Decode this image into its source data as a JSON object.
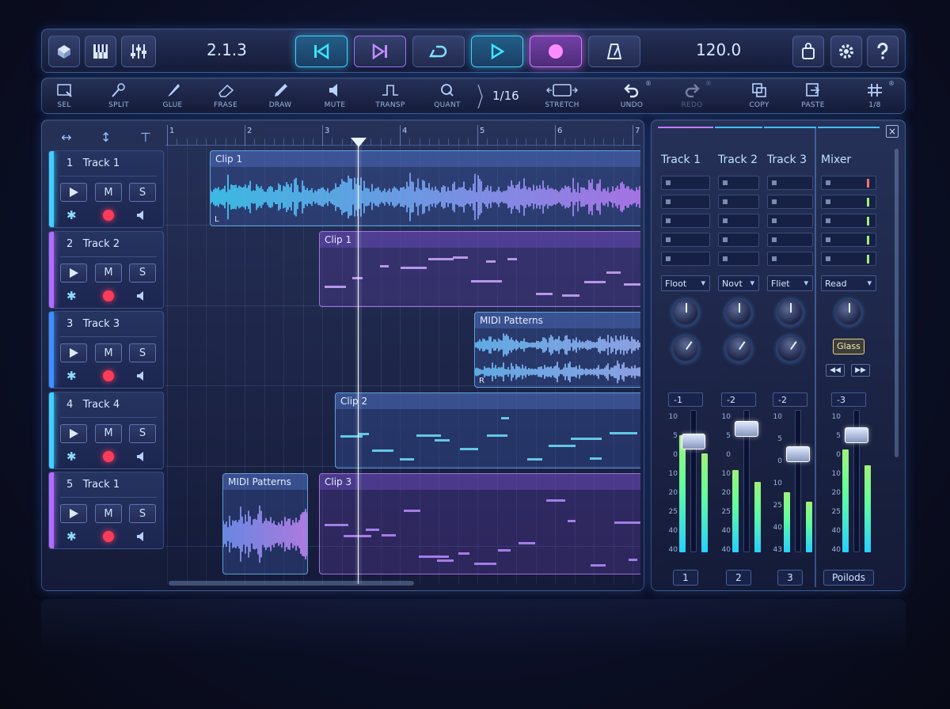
{
  "transport": {
    "position": "2.1.3",
    "tempo": "120.0",
    "buttons": [
      "view-toggle",
      "piano-keys",
      "mixer-view",
      "rewind",
      "skip-forward",
      "loop",
      "play",
      "record",
      "metronome",
      "store",
      "settings",
      "help"
    ]
  },
  "toolbar": {
    "tools": [
      {
        "id": "sel",
        "label": "SEL"
      },
      {
        "id": "split",
        "label": "SPLIT"
      },
      {
        "id": "glue",
        "label": "GLUE"
      },
      {
        "id": "erase",
        "label": "FRASE"
      },
      {
        "id": "draw",
        "label": "DRAW"
      },
      {
        "id": "mute",
        "label": "MUTE"
      },
      {
        "id": "transp",
        "label": "TRANSP"
      },
      {
        "id": "quant",
        "label": "QUANT"
      }
    ],
    "quantize_value": "1/16",
    "stretch_label": "STRETCH",
    "undo_label": "UNDO",
    "redo_label": "REDO",
    "copy_label": "COPY",
    "paste_label": "PASTE",
    "grid_label": "1/8"
  },
  "tracks": [
    {
      "num": "1",
      "name": "Track 1",
      "color": "#3fd0ff",
      "m": "M",
      "s": "S"
    },
    {
      "num": "2",
      "name": "Track 2",
      "color": "#b46cff",
      "m": "M",
      "s": "S"
    },
    {
      "num": "3",
      "name": "Track 3",
      "color": "#3f8fff",
      "m": "M",
      "s": "S"
    },
    {
      "num": "4",
      "name": "Track 4",
      "color": "#3fd0ff",
      "m": "M",
      "s": "S"
    },
    {
      "num": "5",
      "name": "Track 1",
      "color": "#b46cff",
      "m": "M",
      "s": "S"
    }
  ],
  "ruler": [
    "1",
    "2",
    "3",
    "4",
    "5",
    "6",
    "7"
  ],
  "clips": [
    {
      "name": "Clip 1",
      "corner": "L"
    },
    {
      "name": "Clip 1"
    },
    {
      "name": "MIDI Patterns",
      "corner": "R"
    },
    {
      "name": "Clip 2"
    },
    {
      "name": "MIDI Patterns"
    },
    {
      "name": "Clip 3"
    }
  ],
  "mixer": {
    "channels": [
      {
        "name": "Track 1",
        "mode": "Floot",
        "value": "-1",
        "num": "1",
        "level": 0.82
      },
      {
        "name": "Track 2",
        "mode": "Novt",
        "value": "-2",
        "num": "2",
        "level": 0.58
      },
      {
        "name": "Track 3",
        "mode": "Fliet",
        "value": "-2",
        "num": "3",
        "level": 0.42
      },
      {
        "name": "Mixer",
        "mode": "Read",
        "value": "-3",
        "num": "Poilods",
        "fx": "Glass",
        "level": 0.72
      }
    ],
    "scale": [
      "10",
      "5",
      "0",
      "10",
      "20",
      "25",
      "40",
      "40"
    ],
    "scale3": [
      "10",
      "5",
      "0",
      "10",
      "25",
      "40",
      "43"
    ],
    "scale4": [
      "10",
      "5",
      "0",
      "10",
      "20",
      "25",
      "40",
      "40"
    ]
  },
  "colors": {
    "accent_cyan": "#3fd0ff",
    "accent_purple": "#d67bff",
    "record": "#ff3b5a"
  }
}
